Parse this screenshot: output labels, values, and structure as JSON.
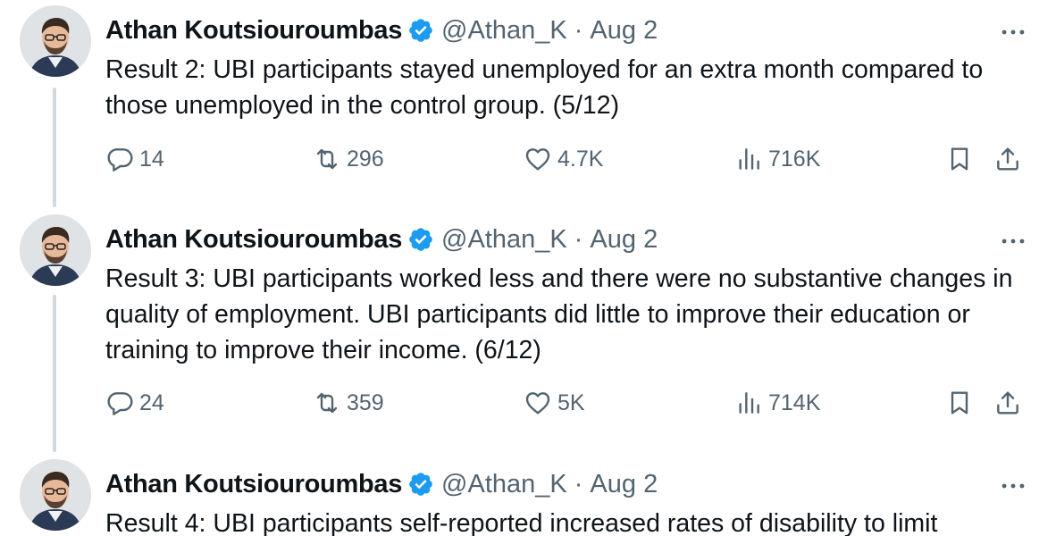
{
  "tweets": [
    {
      "author_name": "Athan Koutsiouroumbas",
      "handle": "@Athan_K",
      "separator": "·",
      "date": "Aug 2",
      "text": "Result 2: UBI participants stayed unemployed for an extra month compared to those unemployed in the control group. (5/12)",
      "replies": "14",
      "reposts": "296",
      "likes": "4.7K",
      "views": "716K"
    },
    {
      "author_name": "Athan Koutsiouroumbas",
      "handle": "@Athan_K",
      "separator": "·",
      "date": "Aug 2",
      "text": "Result 3: UBI participants worked less and there were no substantive changes in quality of employment. UBI participants did little to improve their education or training to improve their income. (6/12)",
      "replies": "24",
      "reposts": "359",
      "likes": "5K",
      "views": "714K"
    },
    {
      "author_name": "Athan Koutsiouroumbas",
      "handle": "@Athan_K",
      "separator": "·",
      "date": "Aug 2",
      "text": "Result 4: UBI participants self-reported increased rates of disability to limit"
    }
  ],
  "icons": {
    "verified": "verified-badge-icon",
    "more": "more-horizontal-icon",
    "reply": "reply-icon",
    "repost": "repost-icon",
    "like": "heart-icon",
    "views": "views-icon",
    "bookmark": "bookmark-icon",
    "share": "share-icon"
  },
  "colors": {
    "verified": "#1d9bf0",
    "text": "#0f1419",
    "secondary": "#536471",
    "thread_line": "#cfd9de"
  }
}
